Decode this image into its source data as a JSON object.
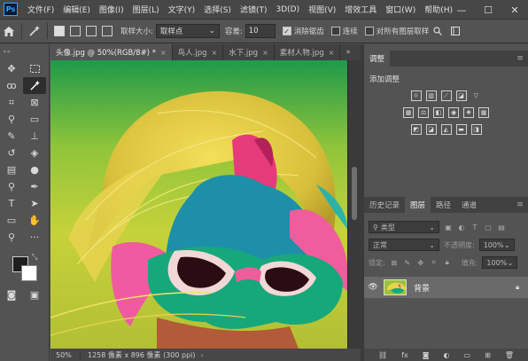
{
  "app": {
    "logo": "Ps"
  },
  "menu": [
    "文件(F)",
    "编辑(E)",
    "图像(I)",
    "图层(L)",
    "文字(Y)",
    "选择(S)",
    "滤镜(T)",
    "3D(D)",
    "视图(V)",
    "增效工具",
    "窗口(W)",
    "帮助(H)"
  ],
  "window_controls": {
    "minimize": "—",
    "maximize": "☐",
    "close": "✕"
  },
  "options": {
    "sample_size_label": "取样大小:",
    "sample_size_value": "取样点",
    "tolerance_label": "容差:",
    "tolerance_value": "10",
    "antialias_label": "消除锯齿",
    "contiguous_label": "连续",
    "all_layers_label": "对所有图层取样"
  },
  "tabs": [
    {
      "label": "头像.jpg @ 50%(RGB/8#) *",
      "active": true
    },
    {
      "label": "鸟人.jpg",
      "active": false
    },
    {
      "label": "水下.jpg",
      "active": false
    },
    {
      "label": "素材人物.jpg",
      "active": false
    }
  ],
  "tab_close": "×",
  "tab_overflow": "»",
  "status": {
    "zoom": "50%",
    "doc_info": "1258 像素 x 896 像素 (300 ppi)",
    "arrow": "›"
  },
  "adjustments": {
    "tab": "调整",
    "title": "添加调整"
  },
  "layers_panel": {
    "tabs": [
      "历史记录",
      "图层",
      "路径",
      "通道"
    ],
    "active_tab": "图层",
    "filter_label": "类型",
    "blend_mode": "正常",
    "opacity_label": "不透明度:",
    "opacity_value": "100%",
    "lock_label": "锁定:",
    "fill_label": "填充:",
    "fill_value": "100%",
    "layer_name": "背景"
  },
  "colors": {
    "accent": "#31a8ff",
    "panel": "#535353",
    "dark": "#282828"
  }
}
